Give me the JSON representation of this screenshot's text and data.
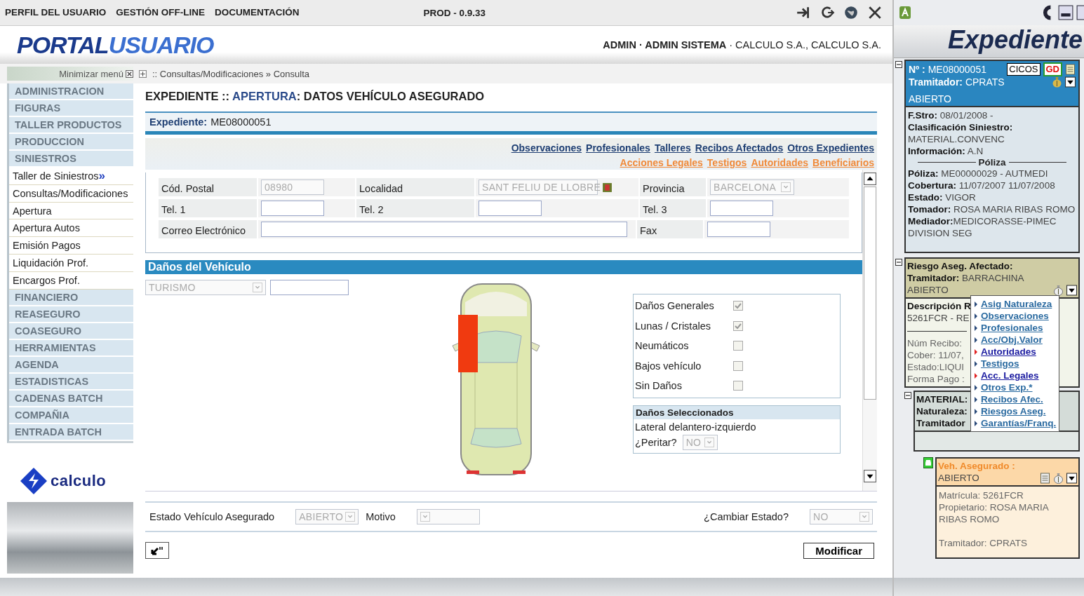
{
  "top_menu": [
    "PERFIL DEL USUARIO",
    "GESTIÓN OFF-LINE",
    "DOCUMENTACIÓN"
  ],
  "version": "PROD - 0.9.33",
  "logo": {
    "part_1": "PORTAL",
    "part_2": "USUARIO"
  },
  "user_line": "**ADMIN · ADMIN SISTEMA** · CALCULO S.A., CALCULO S.A.",
  "minimize_menu": "Minimizar menú",
  "breadcrumb": ":: Consultas/Modificaciones » Consulta",
  "sidebar": {
    "items": [
      {
        "kind": "section",
        "label": "ADMINISTRACION"
      },
      {
        "kind": "section",
        "label": "FIGURAS"
      },
      {
        "kind": "section",
        "label": "TALLER PRODUCTOS"
      },
      {
        "kind": "section",
        "label": "PRODUCCION"
      },
      {
        "kind": "section",
        "label": "SINIESTROS"
      },
      {
        "kind": "link",
        "label": "Taller de Siniestros",
        "marker": "»"
      },
      {
        "kind": "link",
        "label": "Consultas/Modificaciones"
      },
      {
        "kind": "link",
        "label": "Apertura"
      },
      {
        "kind": "link",
        "label": "Apertura Autos"
      },
      {
        "kind": "link",
        "label": "Emisión Pagos"
      },
      {
        "kind": "link",
        "label": "Liquidación Prof."
      },
      {
        "kind": "link",
        "label": "Encargos Prof."
      },
      {
        "kind": "section",
        "label": "FINANCIERO"
      },
      {
        "kind": "section",
        "label": "REASEGURO"
      },
      {
        "kind": "section",
        "label": "COASEGURO"
      },
      {
        "kind": "section",
        "label": "HERRAMIENTAS"
      },
      {
        "kind": "section",
        "label": "AGENDA"
      },
      {
        "kind": "section",
        "label": "ESTADISTICAS"
      },
      {
        "kind": "section",
        "label": "CADENAS BATCH"
      },
      {
        "kind": "section",
        "label": "COMPAÑIA"
      },
      {
        "kind": "section",
        "label": "ENTRADA BATCH"
      }
    ],
    "brand": "calculo"
  },
  "page_title": {
    "prefix": "EXPEDIENTE ::",
    "section": "APERTURA",
    "suffix": ": DATOS VEHÍCULO ASEGURADO"
  },
  "expediente": {
    "label": "Expediente:",
    "value": "ME08000051"
  },
  "link_rows": [
    {
      "color": "#1f3f73",
      "links": [
        "Observaciones",
        "Profesionales",
        "Talleres",
        "Recibos Afectados",
        "Otros Expedientes"
      ]
    },
    {
      "color": "#f08a3a",
      "links": [
        "Acciones Legales",
        "Testigos",
        "Autoridades",
        "Beneficiarios"
      ]
    }
  ],
  "address_form": {
    "rows": [
      [
        {
          "label": "Cód. Postal",
          "kind": "input",
          "value": "08980",
          "disabled": true
        },
        {
          "label": "Localidad",
          "kind": "lookup",
          "value": "SANT FELIU DE LLOBRE",
          "disabled": true
        },
        {
          "label": "Provincia",
          "kind": "select",
          "value": "BARCELONA",
          "disabled": true
        }
      ],
      [
        {
          "label": "Tel. 1",
          "kind": "input",
          "disabled": false
        },
        {
          "label": "Tel. 2",
          "kind": "input",
          "disabled": false
        },
        {
          "label": "Tel. 3",
          "kind": "input",
          "disabled": false
        }
      ],
      [
        {
          "label": "Correo Electrónico",
          "kind": "wide",
          "disabled": false
        },
        "",
        {
          "label": "Fax",
          "kind": "input",
          "disabled": false
        }
      ]
    ]
  },
  "damage": {
    "title": "Daños del Vehículo",
    "vehicle_type": "TURISMO",
    "zones": [
      {
        "kind": "front-left",
        "damaged": true
      }
    ],
    "checks": [
      {
        "label": "Daños Generales",
        "checked": true
      },
      {
        "label": "Lunas / Cristales",
        "checked": true
      },
      {
        "label": "Neumáticos",
        "checked": false
      },
      {
        "label": "Bajos vehículo",
        "checked": false
      },
      {
        "label": "Sin Daños",
        "checked": false
      }
    ],
    "selected_panel": {
      "title": "Daños Seleccionados",
      "item": "Lateral delantero-izquierdo",
      "question": "¿Peritar?",
      "answer": "NO"
    }
  },
  "status_row": [
    {
      "label": "Estado Vehículo Asegurado",
      "value": "ABIERTO"
    },
    {
      "label": "Motivo"
    },
    {
      "label": "¿Cambiar Estado?",
      "value": "NO"
    }
  ],
  "submit_button": "Modificar",
  "right_panel": {
    "title": "Expediente",
    "case_card": {
      "number_label": "Nº :",
      "number": "ME08000051",
      "badges": [
        {
          "label": "CICOS",
          "kind": "plain"
        },
        {
          "label": "GD",
          "kind": "alert"
        }
      ],
      "handler": "**Tramitador:** CPRATS",
      "status": "ABIERTO",
      "details": [
        "**F.Stro:** 08/01/2008 -",
        "**Clasificación Siniestro:**",
        "MATERIAL.CONVENC",
        "**Información:** A.N"
      ],
      "divider_label": "Póliza",
      "policy": [
        "**Póliza:** ME00000029 - AUTMEDI",
        "**Cobertura:** 11/07/2007 11/07/2008",
        "**Estado:** VIGOR",
        "**Tomador:** ROSA MARIA RIBAS ROMO",
        "**Mediador:**MEDICORASSE-PIMEC DIVISION SEG"
      ]
    },
    "risk_card": {
      "title": "Riesgo Aseg. Afectado:",
      "handler": "**Tramitador:** BARRACHINA",
      "status": "ABIERTO",
      "lines_top": [
        "**Descripción R**",
        "5261FCR - RE"
      ],
      "lines_bottom": [
        "Núm Recibo:",
        "Cober: 11/07,",
        "Estado:LIQUI",
        "Forma Pago :"
      ]
    },
    "material_card": {
      "lines": [
        "MATERIAL:",
        "Naturaleza:",
        "Tramitador"
      ]
    },
    "vehicle_card": {
      "title": "Veh. Asegurado :",
      "status": "ABIERTO",
      "lines": [
        "Matrícula: 5261FCR",
        "Propietario: ROSA MARIA RIBAS ROMO",
        "Tramitador: CPRATS"
      ]
    },
    "menu": [
      {
        "label": "Asig Naturaleza",
        "visited": false
      },
      {
        "label": "Observaciones",
        "visited": false
      },
      {
        "label": "Profesionales",
        "visited": false
      },
      {
        "label": "Acc/Obj.Valor",
        "visited": false
      },
      {
        "label": "Autoridades",
        "visited": true
      },
      {
        "label": "Testigos",
        "visited": false
      },
      {
        "label": "Acc. Legales",
        "visited": true
      },
      {
        "label": "Otros Exp.*",
        "visited": false
      },
      {
        "label": "Recibos Afec.",
        "visited": false
      },
      {
        "label": "Riesgos Aseg.",
        "visited": false
      },
      {
        "label": "Garantías/Franq.",
        "visited": false
      }
    ]
  }
}
